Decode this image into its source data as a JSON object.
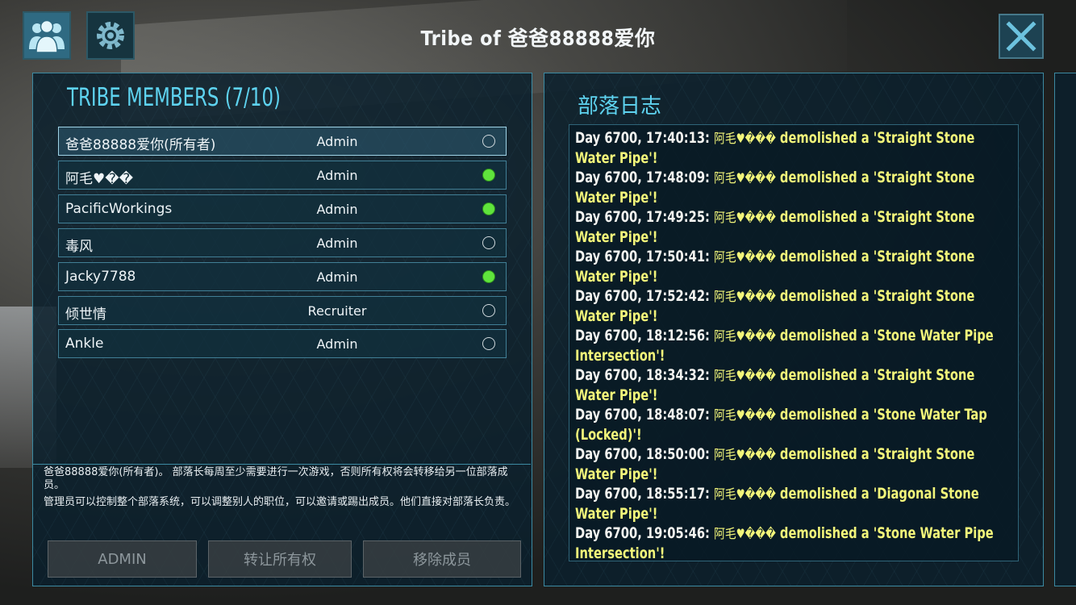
{
  "window_title": "Tribe of 爸爸88888爱你",
  "top_bar": {
    "members_icon": "people-icon",
    "settings_icon": "gear-icon",
    "close_icon": "close-x-icon"
  },
  "members_panel": {
    "title": "TRIBE MEMBERS (7/10)",
    "members": [
      {
        "name": "爸爸88888爱你(所有者)",
        "role": "Admin",
        "online": false,
        "selected": true
      },
      {
        "name": "阿毛♥��",
        "role": "Admin",
        "online": true
      },
      {
        "name": "PacificWorkings",
        "role": "Admin",
        "online": true
      },
      {
        "name": "毒风",
        "role": "Admin",
        "online": false
      },
      {
        "name": "Jacky7788",
        "role": "Admin",
        "online": true
      },
      {
        "name": "倾世情",
        "role": "Recruiter",
        "online": false
      },
      {
        "name": "Ankle",
        "role": "Admin",
        "online": false
      }
    ],
    "info_owner": "爸爸88888爱你(所有者)。 部落长每周至少需要进行一次游戏，否则所有权将会转移给另一位部落成员。",
    "info_admin": "管理员可以控制整个部落系统，可以调整别人的职位，可以邀请或踢出成员。他们直接对部落长负责。",
    "buttons": {
      "admin": "ADMIN",
      "transfer": "转让所有权",
      "remove": "移除成员"
    }
  },
  "log_panel": {
    "title": "部落日志",
    "entries": [
      {
        "stamp": "Day 6700, 17:40:13:",
        "actor": "阿毛♥���",
        "action": "demolished a 'Straight Stone Water Pipe'!"
      },
      {
        "stamp": "Day 6700, 17:48:09:",
        "actor": "阿毛♥���",
        "action": "demolished a 'Straight Stone Water Pipe'!"
      },
      {
        "stamp": "Day 6700, 17:49:25:",
        "actor": "阿毛♥���",
        "action": "demolished a 'Straight Stone Water Pipe'!"
      },
      {
        "stamp": "Day 6700, 17:50:41:",
        "actor": "阿毛♥���",
        "action": "demolished a 'Straight Stone Water Pipe'!"
      },
      {
        "stamp": "Day 6700, 17:52:42:",
        "actor": "阿毛♥���",
        "action": "demolished a 'Straight Stone Water Pipe'!"
      },
      {
        "stamp": "Day 6700, 18:12:56:",
        "actor": "阿毛♥���",
        "action": "demolished a 'Stone Water Pipe Intersection'!"
      },
      {
        "stamp": "Day 6700, 18:34:32:",
        "actor": "阿毛♥���",
        "action": "demolished a 'Straight Stone Water Pipe'!"
      },
      {
        "stamp": "Day 6700, 18:48:07:",
        "actor": "阿毛♥���",
        "action": "demolished a 'Stone Water Tap (Locked)'!"
      },
      {
        "stamp": "Day 6700, 18:50:00:",
        "actor": "阿毛♥���",
        "action": "demolished a 'Straight Stone Water Pipe'!"
      },
      {
        "stamp": "Day 6700, 18:55:17:",
        "actor": "阿毛♥���",
        "action": "demolished a 'Diagonal Stone Water Pipe'!"
      },
      {
        "stamp": "Day 6700, 19:05:46:",
        "actor": "阿毛♥���",
        "action": "demolished a 'Stone Water Pipe Intersection'!"
      }
    ]
  }
}
